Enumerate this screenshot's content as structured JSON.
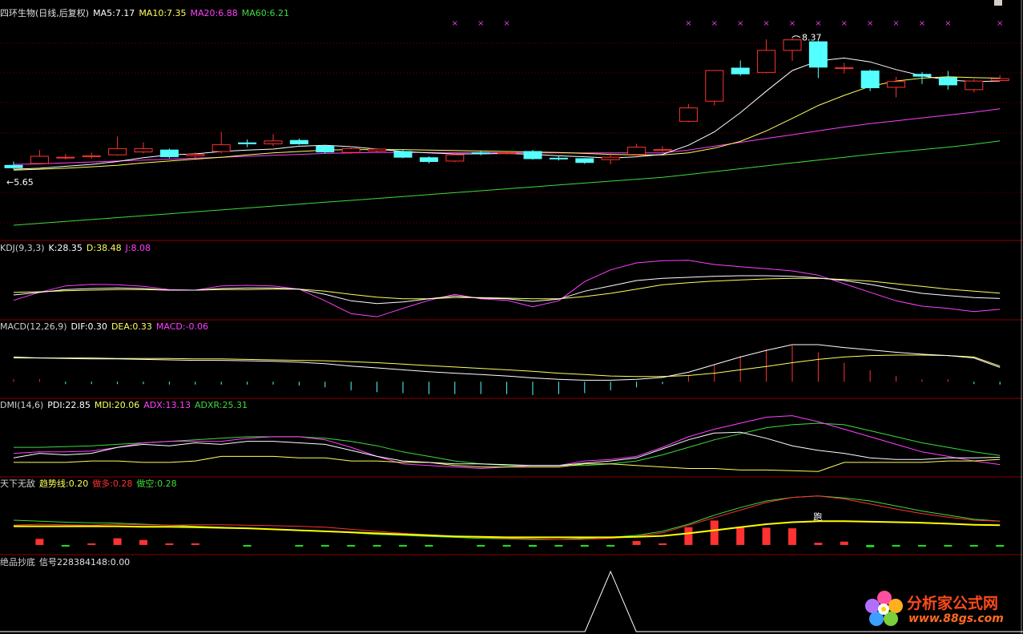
{
  "chart_data": {
    "type": "candlestick",
    "candles": [
      {
        "o": 5.7,
        "c": 5.65,
        "h": 5.78,
        "l": 5.62
      },
      {
        "o": 5.74,
        "c": 5.89,
        "h": 6.02,
        "l": 5.72
      },
      {
        "o": 5.87,
        "c": 5.87,
        "h": 5.94,
        "l": 5.82
      },
      {
        "o": 5.88,
        "c": 5.9,
        "h": 5.97,
        "l": 5.84
      },
      {
        "o": 5.92,
        "c": 6.05,
        "h": 6.3,
        "l": 5.9
      },
      {
        "o": 5.98,
        "c": 6.05,
        "h": 6.18,
        "l": 5.95
      },
      {
        "o": 6.02,
        "c": 5.88,
        "h": 6.05,
        "l": 5.85
      },
      {
        "o": 5.9,
        "c": 5.93,
        "h": 5.97,
        "l": 5.86
      },
      {
        "o": 5.99,
        "c": 6.13,
        "h": 6.4,
        "l": 5.95
      },
      {
        "o": 6.17,
        "c": 6.15,
        "h": 6.24,
        "l": 6.08
      },
      {
        "o": 6.15,
        "c": 6.21,
        "h": 6.35,
        "l": 6.1
      },
      {
        "o": 6.22,
        "c": 6.15,
        "h": 6.26,
        "l": 6.13
      },
      {
        "o": 6.1,
        "c": 5.98,
        "h": 6.12,
        "l": 5.95
      },
      {
        "o": 5.97,
        "c": 6.05,
        "h": 6.1,
        "l": 5.94
      },
      {
        "o": 6.0,
        "c": 6.04,
        "h": 6.06,
        "l": 5.97
      },
      {
        "o": 5.99,
        "c": 5.87,
        "h": 6.02,
        "l": 5.85
      },
      {
        "o": 5.86,
        "c": 5.78,
        "h": 5.89,
        "l": 5.74
      },
      {
        "o": 5.79,
        "c": 5.92,
        "h": 5.96,
        "l": 5.77
      },
      {
        "o": 5.96,
        "c": 5.95,
        "h": 6.01,
        "l": 5.91
      },
      {
        "o": 5.96,
        "c": 5.96,
        "h": 5.99,
        "l": 5.93
      },
      {
        "o": 5.99,
        "c": 5.84,
        "h": 6.02,
        "l": 5.82
      },
      {
        "o": 5.85,
        "c": 5.84,
        "h": 5.91,
        "l": 5.8
      },
      {
        "o": 5.84,
        "c": 5.76,
        "h": 5.85,
        "l": 5.73
      },
      {
        "o": 5.82,
        "c": 5.87,
        "h": 5.96,
        "l": 5.72
      },
      {
        "o": 5.93,
        "c": 6.08,
        "h": 6.15,
        "l": 5.9
      },
      {
        "o": 6.01,
        "c": 6.03,
        "h": 6.1,
        "l": 5.98
      },
      {
        "o": 6.62,
        "c": 6.9,
        "h": 6.98,
        "l": 6.6
      },
      {
        "o": 7.04,
        "c": 7.68,
        "h": 7.69,
        "l": 6.95
      },
      {
        "o": 7.73,
        "c": 7.61,
        "h": 7.89,
        "l": 7.57
      },
      {
        "o": 7.64,
        "c": 8.1,
        "h": 8.33,
        "l": 7.62
      },
      {
        "o": 8.1,
        "c": 8.32,
        "h": 8.37,
        "l": 7.88
      },
      {
        "o": 8.28,
        "c": 7.75,
        "h": 8.3,
        "l": 7.52
      },
      {
        "o": 7.72,
        "c": 7.74,
        "h": 7.84,
        "l": 7.62
      },
      {
        "o": 7.67,
        "c": 7.32,
        "h": 7.7,
        "l": 7.25
      },
      {
        "o": 7.33,
        "c": 7.45,
        "h": 7.55,
        "l": 7.12
      },
      {
        "o": 7.6,
        "c": 7.56,
        "h": 7.65,
        "l": 7.4
      },
      {
        "o": 7.53,
        "c": 7.38,
        "h": 7.67,
        "l": 7.28
      },
      {
        "o": 7.28,
        "c": 7.46,
        "h": 7.5,
        "l": 7.22
      },
      {
        "o": 7.47,
        "c": 7.51,
        "h": 7.58,
        "l": 7.45
      }
    ],
    "ma5": [
      5.62,
      5.64,
      5.68,
      5.72,
      5.78,
      5.86,
      5.92,
      5.94,
      5.99,
      6.02,
      6.04,
      6.1,
      6.12,
      6.09,
      6.04,
      5.99,
      5.96,
      5.94,
      5.94,
      5.95,
      5.93,
      5.9,
      5.88,
      5.85,
      5.88,
      5.93,
      6.12,
      6.4,
      6.8,
      7.25,
      7.68,
      7.88,
      7.94,
      7.86,
      7.7,
      7.57,
      7.48,
      7.45,
      7.46
    ],
    "ma10": [
      5.6,
      5.62,
      5.64,
      5.67,
      5.7,
      5.75,
      5.79,
      5.83,
      5.87,
      5.92,
      5.96,
      5.99,
      6.02,
      6.03,
      6.03,
      6.03,
      6.02,
      6.01,
      6.0,
      5.99,
      5.98,
      5.97,
      5.95,
      5.93,
      5.92,
      5.92,
      5.96,
      6.06,
      6.2,
      6.42,
      6.68,
      6.95,
      7.16,
      7.35,
      7.46,
      7.52,
      7.55,
      7.53,
      7.52
    ],
    "ma20": [
      5.72,
      5.73,
      5.75,
      5.77,
      5.79,
      5.81,
      5.83,
      5.85,
      5.87,
      5.89,
      5.91,
      5.93,
      5.95,
      5.96,
      5.97,
      5.97,
      5.97,
      5.97,
      5.97,
      5.96,
      5.96,
      5.96,
      5.96,
      5.96,
      5.96,
      5.96,
      6.02,
      6.1,
      6.18,
      6.26,
      6.34,
      6.42,
      6.5,
      6.57,
      6.63,
      6.69,
      6.75,
      6.81,
      6.88
    ],
    "ma60": [
      4.45,
      4.49,
      4.53,
      4.57,
      4.61,
      4.65,
      4.69,
      4.73,
      4.77,
      4.81,
      4.85,
      4.89,
      4.93,
      4.97,
      5.01,
      5.05,
      5.09,
      5.13,
      5.17,
      5.21,
      5.25,
      5.29,
      5.33,
      5.37,
      5.41,
      5.45,
      5.51,
      5.57,
      5.63,
      5.69,
      5.75,
      5.81,
      5.87,
      5.93,
      5.98,
      6.03,
      6.08,
      6.14,
      6.21
    ],
    "price_range": [
      4.3,
      8.75
    ],
    "high_label": "8.37",
    "low_label": "←5.65",
    "top_markers_at": [
      17,
      18,
      19,
      26,
      27,
      28,
      29,
      30,
      31,
      32,
      33,
      34,
      35,
      36,
      38
    ],
    "kdj": {
      "k": [
        35,
        40,
        45,
        47,
        48,
        47,
        44,
        44,
        47,
        48,
        48,
        46,
        36,
        24,
        19,
        22,
        28,
        33,
        29,
        28,
        23,
        27,
        42,
        52,
        62,
        66,
        68,
        70,
        71,
        71,
        70,
        67,
        62,
        55,
        46,
        38,
        34,
        30,
        28.35
      ],
      "d": [
        40,
        41,
        43,
        44,
        45,
        45,
        44,
        44,
        45,
        45,
        46,
        46,
        42,
        36,
        31,
        28,
        28,
        30,
        30,
        29,
        28,
        28,
        32,
        38,
        46,
        54,
        58,
        61,
        63,
        65,
        66,
        66,
        64,
        61,
        56,
        51,
        46,
        42,
        38.48
      ],
      "j": [
        25,
        40,
        52,
        55,
        54,
        51,
        45,
        44,
        52,
        53,
        52,
        46,
        24,
        0,
        -6,
        10,
        25,
        36,
        28,
        25,
        13,
        24,
        60,
        82,
        95,
        99,
        100,
        92,
        88,
        84,
        80,
        72,
        56,
        40,
        24,
        14,
        10,
        4,
        8.08
      ]
    },
    "macd": {
      "dif": [
        0.52,
        0.5,
        0.49,
        0.48,
        0.48,
        0.47,
        0.46,
        0.45,
        0.45,
        0.44,
        0.43,
        0.41,
        0.38,
        0.33,
        0.29,
        0.25,
        0.21,
        0.18,
        0.15,
        0.12,
        0.08,
        0.05,
        0.03,
        0.03,
        0.05,
        0.09,
        0.2,
        0.36,
        0.52,
        0.66,
        0.78,
        0.78,
        0.72,
        0.67,
        0.62,
        0.58,
        0.55,
        0.5,
        0.3
      ],
      "dea": [
        0.5,
        0.5,
        0.5,
        0.5,
        0.49,
        0.49,
        0.49,
        0.48,
        0.48,
        0.47,
        0.46,
        0.45,
        0.44,
        0.42,
        0.4,
        0.37,
        0.34,
        0.31,
        0.28,
        0.25,
        0.22,
        0.18,
        0.15,
        0.12,
        0.11,
        0.11,
        0.13,
        0.18,
        0.25,
        0.32,
        0.4,
        0.47,
        0.52,
        0.55,
        0.56,
        0.56,
        0.55,
        0.52,
        0.33
      ],
      "macd_range": [
        -0.3,
        1.05
      ]
    },
    "dmi": {
      "pdi": [
        22,
        28,
        26,
        28,
        36,
        40,
        38,
        42,
        40,
        44,
        44,
        42,
        40,
        32,
        24,
        18,
        16,
        14,
        14,
        13,
        12,
        12,
        15,
        18,
        22,
        34,
        46,
        55,
        56,
        48,
        38,
        32,
        28,
        22,
        20,
        20,
        22,
        22,
        22.85
      ],
      "mdi": [
        16,
        16,
        16,
        18,
        18,
        16,
        16,
        18,
        24,
        24,
        24,
        22,
        22,
        18,
        18,
        16,
        16,
        12,
        10,
        10,
        10,
        10,
        14,
        14,
        12,
        10,
        8,
        8,
        6,
        6,
        5,
        4,
        16,
        16,
        16,
        16,
        18,
        18,
        20.06
      ],
      "adx": [
        28,
        30,
        30,
        31,
        36,
        42,
        44,
        44,
        44,
        48,
        50,
        50,
        46,
        36,
        24,
        14,
        12,
        10,
        8,
        10,
        12,
        12,
        18,
        20,
        24,
        36,
        50,
        60,
        68,
        76,
        78,
        70,
        60,
        50,
        40,
        30,
        24,
        18,
        13.13
      ],
      "adxr": [
        36,
        36,
        37,
        38,
        40,
        42,
        44,
        46,
        48,
        50,
        50,
        50,
        48,
        44,
        38,
        30,
        24,
        18,
        14,
        12,
        12,
        12,
        12,
        14,
        18,
        26,
        36,
        46,
        54,
        62,
        66,
        68,
        66,
        58,
        50,
        42,
        36,
        30,
        25.31
      ]
    },
    "tianxia": {
      "zuoduo": [
        0.2,
        0.22,
        0.21,
        0.2,
        0.22,
        0.21,
        0.2,
        0.21,
        0.21,
        0.2,
        0.19,
        0.18,
        0.16,
        0.12,
        0.08,
        0.04,
        0.01,
        -0.02,
        -0.04,
        -0.06,
        -0.07,
        -0.08,
        -0.08,
        -0.06,
        -0.02,
        0.05,
        0.2,
        0.35,
        0.5,
        0.65,
        0.75,
        0.78,
        0.72,
        0.62,
        0.52,
        0.43,
        0.36,
        0.3,
        0.28
      ],
      "zuokong": [
        0.3,
        0.28,
        0.26,
        0.25,
        0.24,
        0.22,
        0.2,
        0.18,
        0.16,
        0.14,
        0.12,
        0.1,
        0.08,
        0.05,
        0.02,
        0.0,
        -0.02,
        -0.04,
        -0.06,
        -0.07,
        -0.08,
        -0.08,
        -0.06,
        -0.04,
        0.0,
        0.08,
        0.22,
        0.4,
        0.55,
        0.68,
        0.75,
        0.78,
        0.74,
        0.68,
        0.58,
        0.48,
        0.4,
        0.32,
        0.28
      ],
      "trend": [
        0.18,
        0.18,
        0.18,
        0.18,
        0.18,
        0.17,
        0.17,
        0.16,
        0.15,
        0.14,
        0.12,
        0.1,
        0.08,
        0.06,
        0.04,
        0.02,
        0.0,
        -0.02,
        -0.03,
        -0.04,
        -0.04,
        -0.04,
        -0.04,
        -0.04,
        -0.03,
        -0.01,
        0.04,
        0.1,
        0.16,
        0.22,
        0.26,
        0.28,
        0.28,
        0.27,
        0.26,
        0.25,
        0.23,
        0.21,
        0.2
      ],
      "bars": [
        0,
        1.1,
        -0.02,
        0.05,
        1.2,
        0.9,
        0.01,
        0.3,
        0.0,
        -0.08,
        0.0,
        -0.06,
        -0.1,
        -0.1,
        -0.08,
        -0.08,
        -0.25,
        0.0,
        -0.12,
        -0.15,
        -0.32,
        -0.28,
        -0.3,
        -0.08,
        0.7,
        0.2,
        3.2,
        4.4,
        3.1,
        3.1,
        3.0,
        0.4,
        0.6,
        -0.4,
        -0.08,
        -0.08,
        -0.06,
        -0.1,
        -0.3
      ],
      "y_range": [
        -0.35,
        0.95
      ],
      "bar_scale": 0.2,
      "mark_text": "跑",
      "mark_index": 31
    },
    "jp": {
      "signal_peak_index": 23
    }
  },
  "headers": {
    "main": {
      "title": "四环生物(日线,后复权)",
      "ma5": "MA5:7.17",
      "ma10": "MA10:7.35",
      "ma20": "MA20:6.88",
      "ma60": "MA60:6.21"
    },
    "kdj": {
      "name": "KDJ(9,3,3)",
      "k": "K:28.35",
      "d": "D:38.48",
      "j": "J:8.08"
    },
    "macd": {
      "name": "MACD(12,26,9)",
      "dif": "DIF:0.30",
      "dea": "DEA:0.33",
      "macd": "MACD:-0.06"
    },
    "dmi": {
      "name": "DMI(14,6)",
      "pdi": "PDI:22.85",
      "mdi": "MDI:20.06",
      "adx": "ADX:13.13",
      "adxr": "ADXR:25.31"
    },
    "tianxia": {
      "name": "天下无敌",
      "trend": "趋势线:0.20",
      "zuoduo": "做多:0.28",
      "zuokong": "做空:0.28"
    },
    "jp": {
      "name": "绝品抄底",
      "signal": "信号228384148:0.00"
    }
  },
  "watermark": {
    "name": "分析家公式网",
    "url": "www.88gs.com"
  },
  "colors": {
    "up": "#ff3232",
    "down": "#54ffff",
    "ma5": "#ffffff",
    "ma10": "#ffff5c",
    "ma20": "#ff40ff",
    "ma60": "#3cdc3c",
    "separator": "#8b0000",
    "grid": "#7a0000",
    "marker": "#e040e0"
  }
}
